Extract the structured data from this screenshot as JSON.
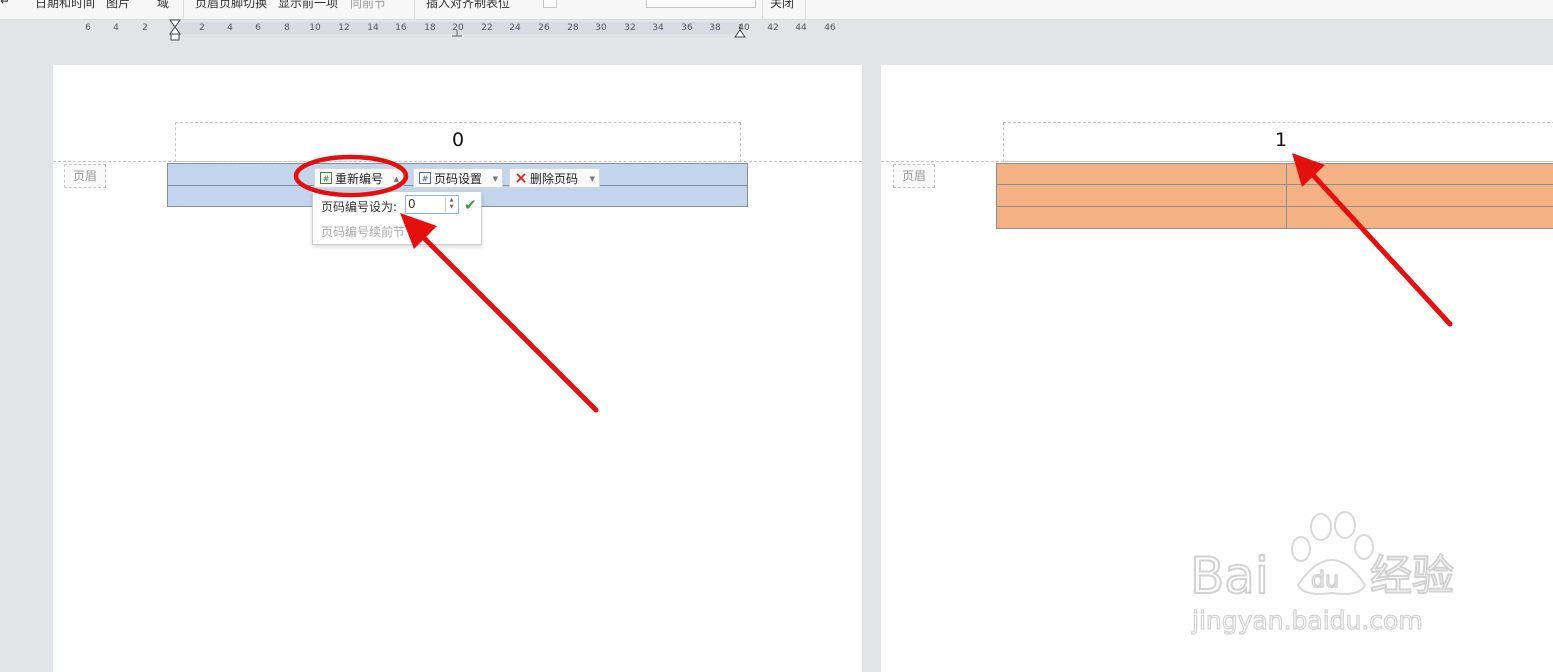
{
  "toolbar": {
    "items": [
      "日期和时间",
      "图片",
      "域",
      "页眉页脚切换",
      "显示前一项",
      "同前节",
      "插入对齐制表位",
      "关闭"
    ]
  },
  "ruler": {
    "ticks": [
      "6",
      "4",
      "2",
      "2",
      "4",
      "6",
      "8",
      "10",
      "12",
      "14",
      "16",
      "18",
      "20",
      "22",
      "24",
      "26",
      "28",
      "30",
      "32",
      "34",
      "36",
      "38",
      "40",
      "42",
      "44",
      "46"
    ]
  },
  "page1": {
    "page_number": "0",
    "header_tag": "页眉",
    "renumber_button": "重新编号",
    "page_number_settings_button": "页码设置",
    "delete_page_number_button": "删除页码",
    "dropdown": {
      "set_label": "页码编号设为:",
      "set_value": "0",
      "continue_label": "页码编号续前节"
    }
  },
  "page2": {
    "page_number": "1",
    "header_tag": "页眉"
  },
  "colors": {
    "table_blue": "#c2d5ec",
    "table_orange": "#f4b183",
    "arrow_red": "#e41010"
  },
  "watermark": {
    "brand": "Bai",
    "brand2": "du",
    "brand_cn": "经验",
    "url": "jingyan.baidu.com"
  }
}
